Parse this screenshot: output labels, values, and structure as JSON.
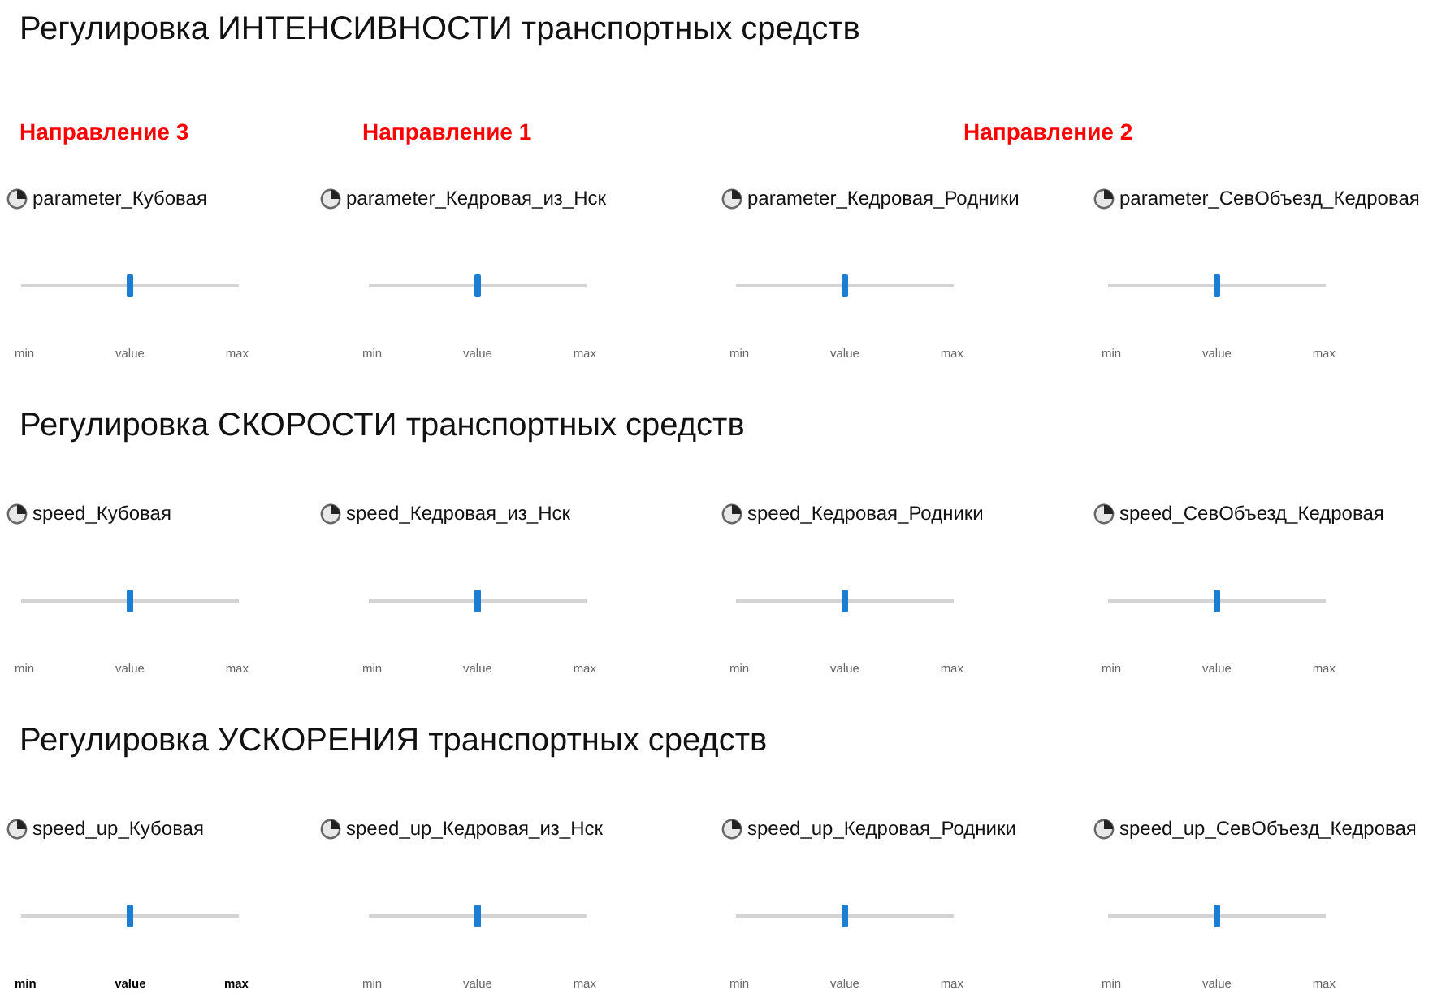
{
  "sections": [
    {
      "title": "Регулировка ИНТЕНСИВНОСТИ транспортных средств",
      "directions": [
        "Направление 3",
        "Направление 1",
        "Направление 2"
      ],
      "controls": [
        {
          "label": "parameter_Кубовая",
          "level": 0.5,
          "min_label": "min",
          "value_label": "value",
          "max_label": "max",
          "focused": false
        },
        {
          "label": "parameter_Кедровая_из_Нск",
          "level": 0.5,
          "min_label": "min",
          "value_label": "value",
          "max_label": "max",
          "focused": false
        },
        {
          "label": "parameter_Кедровая_Родники",
          "level": 0.5,
          "min_label": "min",
          "value_label": "value",
          "max_label": "max",
          "focused": false
        },
        {
          "label": "parameter_СевОбъезд_Кедровая",
          "level": 0.5,
          "min_label": "min",
          "value_label": "value",
          "max_label": "max",
          "focused": false
        }
      ]
    },
    {
      "title": "Регулировка СКОРОСТИ транспортных средств",
      "controls": [
        {
          "label": "speed_Кубовая",
          "level": 0.5,
          "min_label": "min",
          "value_label": "value",
          "max_label": "max",
          "focused": false
        },
        {
          "label": "speed_Кедровая_из_Нск",
          "level": 0.5,
          "min_label": "min",
          "value_label": "value",
          "max_label": "max",
          "focused": false
        },
        {
          "label": "speed_Кедровая_Родники",
          "level": 0.5,
          "min_label": "min",
          "value_label": "value",
          "max_label": "max",
          "focused": false
        },
        {
          "label": "speed_СевОбъезд_Кедровая",
          "level": 0.5,
          "min_label": "min",
          "value_label": "value",
          "max_label": "max",
          "focused": false
        }
      ]
    },
    {
      "title": "Регулировка УСКОРЕНИЯ транспортных средств",
      "controls": [
        {
          "label": "speed_up_Кубовая",
          "level": 0.5,
          "min_label": "min",
          "value_label": "value",
          "max_label": "max",
          "focused": true
        },
        {
          "label": "speed_up_Кедровая_из_Нск",
          "level": 0.5,
          "min_label": "min",
          "value_label": "value",
          "max_label": "max",
          "focused": false
        },
        {
          "label": "speed_up_Кедровая_Родники",
          "level": 0.5,
          "min_label": "min",
          "value_label": "value",
          "max_label": "max",
          "focused": false
        },
        {
          "label": "speed_up_СевОбъезд_Кедровая",
          "level": 0.5,
          "min_label": "min",
          "value_label": "value",
          "max_label": "max",
          "focused": false
        }
      ]
    }
  ]
}
